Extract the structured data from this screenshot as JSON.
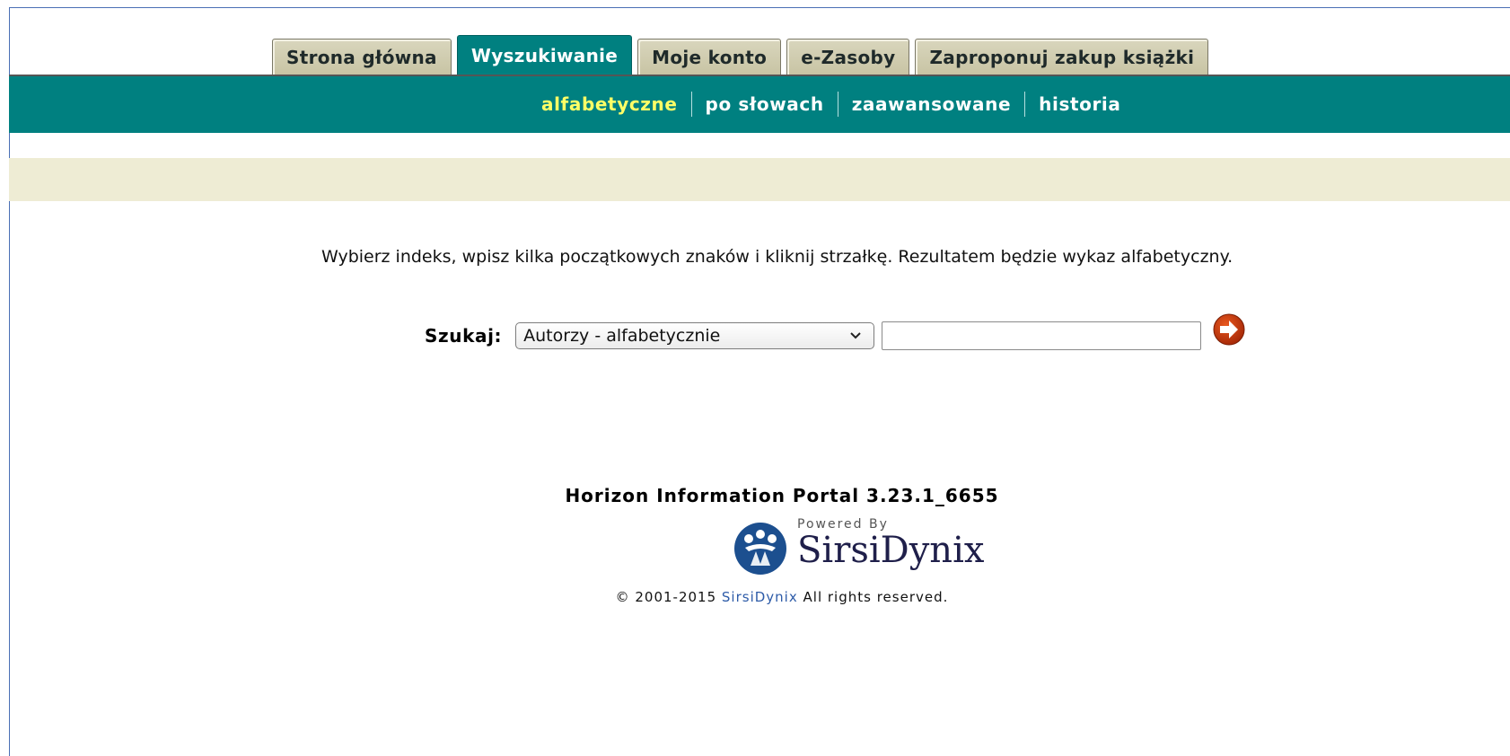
{
  "tabs": [
    {
      "label": "Strona główna",
      "active": false
    },
    {
      "label": "Wyszukiwanie",
      "active": true
    },
    {
      "label": "Moje konto",
      "active": false
    },
    {
      "label": "e-Zasoby",
      "active": false
    },
    {
      "label": "Zaproponuj zakup książki",
      "active": false
    }
  ],
  "subnav": [
    {
      "label": "alfabetyczne",
      "active": true
    },
    {
      "label": "po słowach",
      "active": false
    },
    {
      "label": "zaawansowane",
      "active": false
    },
    {
      "label": "historia",
      "active": false
    }
  ],
  "instruction": "Wybierz indeks, wpisz kilka początkowych znaków i kliknij strzałkę. Rezultatem będzie wykaz alfabetyczny.",
  "search": {
    "label": "Szukaj:",
    "index_selected": "Autorzy - alfabetycznie",
    "query_value": ""
  },
  "footer": {
    "title": "Horizon Information Portal 3.23.1_6655",
    "logo_powered": "Powered By",
    "logo_brand": "SirsiDynix",
    "copyright_prefix": "© 2001-2015",
    "copyright_link": "SirsiDynix",
    "copyright_suffix": "All rights reserved."
  },
  "colors": {
    "teal": "#008080",
    "active_subnav": "#ffff66",
    "band": "#eeecd4",
    "go_button": "#cc3300",
    "link": "#2d5ba8"
  },
  "icons": {
    "go": "arrow-right-circle-icon",
    "dropdown": "chevron-down-icon",
    "logo": "sirsidynix-logo-icon"
  }
}
